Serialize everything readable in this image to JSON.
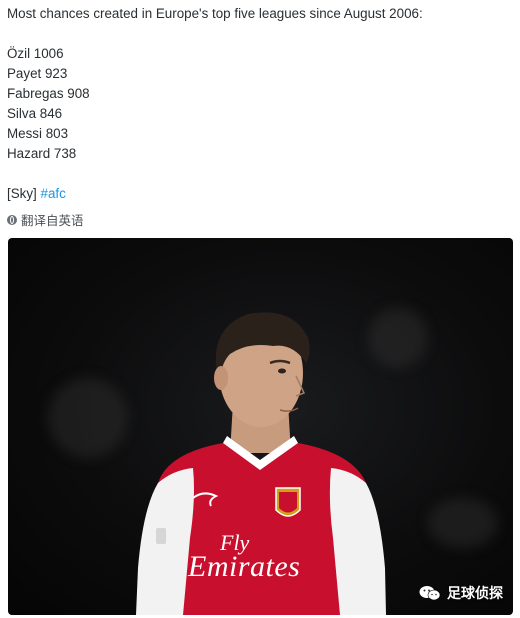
{
  "tweet": {
    "headline": "Most chances created in Europe's top five leagues since August 2006:",
    "rows": [
      "Özil 1006",
      "Payet 923",
      "Fabregas 908",
      "Silva 846",
      "Messi 803",
      "Hazard 738"
    ],
    "source": "[Sky]",
    "hashtag": "#afc"
  },
  "translate": {
    "icon": "globe-icon",
    "label": "翻译自英语"
  },
  "media": {
    "shirt_sponsor_line1": "Fly",
    "shirt_sponsor_line2": "Emirates",
    "watermark_icon": "wechat-icon",
    "watermark_text": "足球侦探"
  },
  "colors": {
    "text": "#292f33",
    "link": "#1b95e0",
    "shirt_red": "#c8102e",
    "sleeve_white": "#f2f2f2"
  }
}
